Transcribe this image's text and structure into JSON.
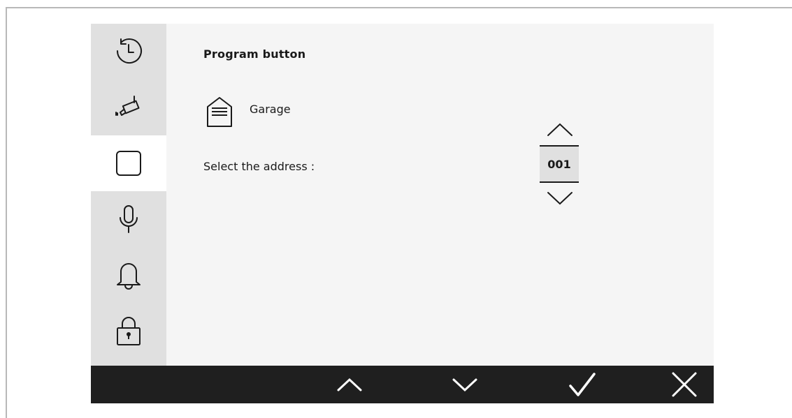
{
  "content": {
    "title": "Program button",
    "device_label": "Garage",
    "address_label": "Select the address :",
    "address_value": "001"
  },
  "sidebar": {
    "items": [
      {
        "icon": "history-icon",
        "active": false
      },
      {
        "icon": "camera-icon",
        "active": false
      },
      {
        "icon": "button-square-icon",
        "active": true
      },
      {
        "icon": "microphone-icon",
        "active": false
      },
      {
        "icon": "bell-icon",
        "active": false
      },
      {
        "icon": "lock-icon",
        "active": false
      }
    ]
  },
  "bottom_bar": {
    "buttons": [
      "chevron-up-icon",
      "chevron-down-icon",
      "check-icon",
      "close-icon"
    ]
  },
  "colors": {
    "screen_bg": "#f5f5f5",
    "sidebar_bg": "#e0e0e0",
    "active_item_bg": "#ffffff",
    "bottom_bar_bg": "#1f1f1f",
    "bottom_bar_icon": "#ffffff",
    "icon_stroke": "#1a1a1a"
  }
}
